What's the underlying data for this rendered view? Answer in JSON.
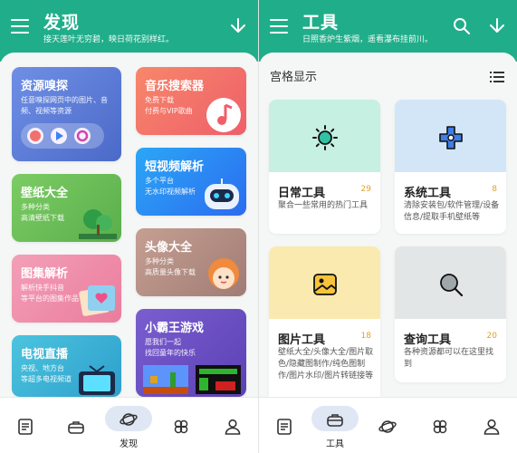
{
  "left": {
    "header": {
      "title": "发现",
      "subtitle": "接天莲叶无穷碧，映日荷花别样红。",
      "download_icon": "download-arrow-icon"
    },
    "cards": [
      {
        "id": "resource",
        "title": "资源嗅探",
        "desc": "任意嗅探网页中的图片、音频、视频等资源",
        "color": "#5b7fd6"
      },
      {
        "id": "music",
        "title": "音乐搜索器",
        "desc": "免费下载\n付费与VIP歌曲",
        "color": "#f0766e"
      },
      {
        "id": "wallpaper",
        "title": "壁纸大全",
        "desc": "多种分类\n高清壁纸下载",
        "color": "#6cbf5c"
      },
      {
        "id": "shortvideo",
        "title": "短视频解析",
        "desc": "多个平台\n无水印视频解析",
        "color": "#2b8ff2"
      },
      {
        "id": "atlas",
        "title": "图集解析",
        "desc": "解析快手抖音\n等平台的图集作品",
        "color": "#ee86a6"
      },
      {
        "id": "avatar",
        "title": "头像大全",
        "desc": "多种分类\n高质量头像下载",
        "color": "#b68f86"
      },
      {
        "id": "tv",
        "title": "电视直播",
        "desc": "央视、地方台\n等超多电视频道",
        "color": "#3eb4d6"
      },
      {
        "id": "game",
        "title": "小霸王游戏",
        "desc": "愿我们一起\n找回童年的快乐",
        "color": "#6a4fc2"
      }
    ],
    "nav": [
      {
        "name": "docs",
        "icon": "document-icon"
      },
      {
        "name": "tools",
        "icon": "toolbox-icon"
      },
      {
        "name": "discover",
        "icon": "planet-icon",
        "label": "发现",
        "active": true
      },
      {
        "name": "clover",
        "icon": "clover-icon"
      },
      {
        "name": "profile",
        "icon": "user-icon"
      }
    ]
  },
  "right": {
    "header": {
      "title": "工具",
      "subtitle": "日照香炉生紫烟，遥看瀑布挂前川。"
    },
    "view_mode": "宫格显示",
    "tools": [
      {
        "id": "daily",
        "title": "日常工具",
        "count": "29",
        "desc": "聚合一些常用的热门工具",
        "color": "#c6f0e2"
      },
      {
        "id": "system",
        "title": "系统工具",
        "count": "8",
        "desc": "清除安装包/软件管理/设备信息/提取手机壁纸等",
        "color": "#d3e6f7"
      },
      {
        "id": "image",
        "title": "图片工具",
        "count": "18",
        "desc": "壁纸大全/头像大全/图片取色/隐藏图制作/纯色图制作/图片水印/图片转链接等",
        "color": "#fbeab0"
      },
      {
        "id": "query",
        "title": "查询工具",
        "count": "20",
        "desc": "各种资源都可以在这里找到",
        "color": "#e2e6e7"
      }
    ],
    "nav": [
      {
        "name": "docs",
        "icon": "document-icon"
      },
      {
        "name": "tools",
        "icon": "toolbox-icon",
        "label": "工具",
        "active": true
      },
      {
        "name": "discover",
        "icon": "planet-icon"
      },
      {
        "name": "clover",
        "icon": "clover-icon"
      },
      {
        "name": "profile",
        "icon": "user-icon"
      }
    ]
  }
}
